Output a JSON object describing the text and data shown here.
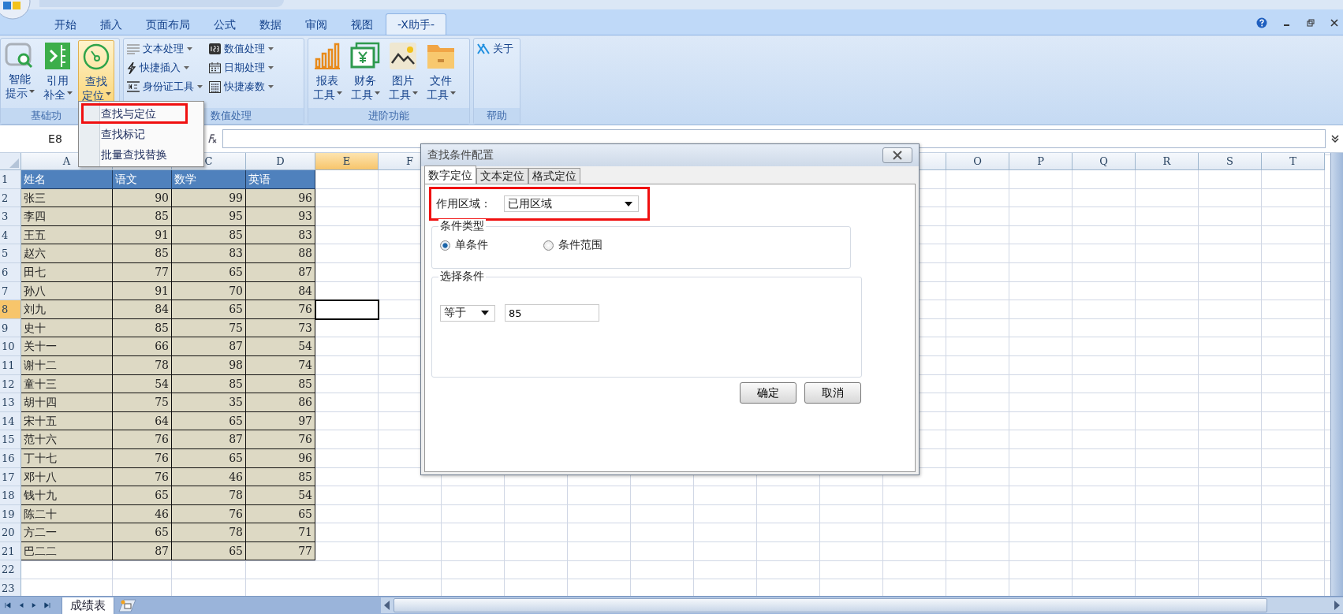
{
  "window": {
    "controls": [
      {
        "kind": "help"
      },
      {
        "kind": "minimize"
      },
      {
        "kind": "restore"
      },
      {
        "kind": "close"
      }
    ]
  },
  "ribbon_tabs": [
    {
      "label": "开始",
      "selected": false
    },
    {
      "label": "插入",
      "selected": false
    },
    {
      "label": "页面布局",
      "selected": false
    },
    {
      "label": "公式",
      "selected": false
    },
    {
      "label": "数据",
      "selected": false
    },
    {
      "label": "审阅",
      "selected": false
    },
    {
      "label": "视图",
      "selected": false
    },
    {
      "label": "-X助手-",
      "selected": true
    }
  ],
  "ribbon_groups": [
    {
      "label": "基础功",
      "big_buttons": [
        {
          "kind": "smart",
          "lines": [
            "智能",
            "提示"
          ],
          "selected": false
        },
        {
          "kind": "quote",
          "lines": [
            "引用",
            "补全"
          ],
          "selected": false
        },
        {
          "kind": "locate",
          "lines": [
            "查找",
            "定位"
          ],
          "selected": true
        }
      ]
    },
    {
      "label": "数值处理",
      "small_buttons": [
        {
          "kind": "text",
          "label": "文本处理",
          "has_menu": true
        },
        {
          "kind": "number",
          "label": "数值处理",
          "has_menu": true
        },
        {
          "kind": "insert",
          "label": "快捷插入",
          "has_menu": true
        },
        {
          "kind": "date",
          "label": "日期处理",
          "has_menu": true
        },
        {
          "kind": "id",
          "label": "身份证工具",
          "has_menu": true
        },
        {
          "kind": "sum",
          "label": "快捷凑数",
          "has_menu": true
        }
      ]
    },
    {
      "label": "进阶功能",
      "big_buttons": [
        {
          "kind": "report",
          "lines": [
            "报表",
            "工具"
          ],
          "selected": false
        },
        {
          "kind": "finance",
          "lines": [
            "财务",
            "工具"
          ],
          "selected": false
        },
        {
          "kind": "image",
          "lines": [
            "图片",
            "工具"
          ],
          "selected": false
        },
        {
          "kind": "file",
          "lines": [
            "文件",
            "工具"
          ],
          "selected": false
        }
      ]
    },
    {
      "label": "帮助",
      "small_buttons": [
        {
          "kind": "about",
          "label": "关于",
          "has_menu": false
        }
      ]
    }
  ],
  "dropdown_menu": {
    "items": [
      {
        "label": "查找与定位",
        "highlighted": true
      },
      {
        "label": "查找标记",
        "highlighted": false
      },
      {
        "label": "批量查找替换",
        "highlighted": false
      }
    ]
  },
  "name_box": {
    "value": "E8"
  },
  "sheet": {
    "columns": [
      {
        "label": "A",
        "selected": false
      },
      {
        "kind": "covered"
      },
      {
        "label": "C",
        "selected": false
      },
      {
        "label": "D",
        "selected": false
      },
      {
        "label": "E",
        "selected": true
      },
      {
        "label": "F",
        "selected": false
      },
      {
        "kind": "hidden"
      },
      {
        "kind": "hidden"
      },
      {
        "kind": "hidden"
      },
      {
        "kind": "hidden"
      },
      {
        "kind": "hidden"
      },
      {
        "kind": "hidden"
      },
      {
        "kind": "hidden"
      },
      {
        "kind": "covered"
      },
      {
        "label": "O",
        "selected": false
      },
      {
        "label": "P",
        "selected": false
      },
      {
        "label": "Q",
        "selected": false
      },
      {
        "label": "R",
        "selected": false
      },
      {
        "label": "S",
        "selected": false
      },
      {
        "label": "T",
        "selected": false
      }
    ],
    "rows": [
      {
        "number": "1",
        "kind": "header",
        "selected": false,
        "cells": [
          "姓名",
          "语文",
          "数学",
          "英语"
        ]
      },
      {
        "number": "2",
        "kind": "data",
        "selected": false,
        "cells": [
          "张三",
          "90",
          "99",
          "96"
        ]
      },
      {
        "number": "3",
        "kind": "data",
        "selected": false,
        "cells": [
          "李四",
          "85",
          "95",
          "93"
        ]
      },
      {
        "number": "4",
        "kind": "data",
        "selected": false,
        "cells": [
          "王五",
          "91",
          "85",
          "83"
        ]
      },
      {
        "number": "5",
        "kind": "data",
        "selected": false,
        "cells": [
          "赵六",
          "85",
          "83",
          "88"
        ]
      },
      {
        "number": "6",
        "kind": "data",
        "selected": false,
        "cells": [
          "田七",
          "77",
          "65",
          "87"
        ]
      },
      {
        "number": "7",
        "kind": "data",
        "selected": false,
        "cells": [
          "孙八",
          "91",
          "70",
          "84"
        ]
      },
      {
        "number": "8",
        "kind": "data",
        "selected": true,
        "cells": [
          "刘九",
          "84",
          "65",
          "76"
        ]
      },
      {
        "number": "9",
        "kind": "data",
        "selected": false,
        "cells": [
          "史十",
          "85",
          "75",
          "73"
        ]
      },
      {
        "number": "10",
        "kind": "data",
        "selected": false,
        "cells": [
          "关十一",
          "66",
          "87",
          "54"
        ]
      },
      {
        "number": "11",
        "kind": "data",
        "selected": false,
        "cells": [
          "谢十二",
          "78",
          "98",
          "74"
        ]
      },
      {
        "number": "12",
        "kind": "data",
        "selected": false,
        "cells": [
          "童十三",
          "54",
          "85",
          "85"
        ]
      },
      {
        "number": "13",
        "kind": "data",
        "selected": false,
        "cells": [
          "胡十四",
          "75",
          "35",
          "86"
        ]
      },
      {
        "number": "14",
        "kind": "data",
        "selected": false,
        "cells": [
          "宋十五",
          "64",
          "65",
          "97"
        ]
      },
      {
        "number": "15",
        "kind": "data",
        "selected": false,
        "cells": [
          "范十六",
          "76",
          "87",
          "76"
        ]
      },
      {
        "number": "16",
        "kind": "data",
        "selected": false,
        "cells": [
          "丁十七",
          "76",
          "65",
          "96"
        ]
      },
      {
        "number": "17",
        "kind": "data",
        "selected": false,
        "cells": [
          "邓十八",
          "76",
          "46",
          "85"
        ]
      },
      {
        "number": "18",
        "kind": "data",
        "selected": false,
        "cells": [
          "钱十九",
          "65",
          "78",
          "54"
        ]
      },
      {
        "number": "19",
        "kind": "data",
        "selected": false,
        "cells": [
          "陈二十",
          "46",
          "76",
          "65"
        ]
      },
      {
        "number": "20",
        "kind": "data",
        "selected": false,
        "cells": [
          "方二一",
          "65",
          "78",
          "71"
        ]
      },
      {
        "number": "21",
        "kind": "data",
        "selected": false,
        "cells": [
          "巴二二",
          "87",
          "65",
          "77"
        ]
      },
      {
        "number": "22",
        "kind": "empty",
        "selected": false
      },
      {
        "number": "23",
        "kind": "empty",
        "selected": false
      }
    ]
  },
  "dialog": {
    "title": "查找条件配置",
    "tabs": [
      {
        "label": "数字定位",
        "selected": true
      },
      {
        "label": "文本定位",
        "selected": false
      },
      {
        "label": "格式定位",
        "selected": false
      }
    ],
    "area": {
      "label": "作用区域：",
      "value": "已用区域",
      "highlighted": true
    },
    "condition_type": {
      "legend": "条件类型",
      "options": [
        {
          "label": "单条件",
          "selected": true
        },
        {
          "label": "条件范围",
          "selected": false
        }
      ]
    },
    "condition": {
      "legend": "选择条件",
      "operator": "等于",
      "value": "85"
    },
    "buttons": [
      "确定",
      "取消"
    ]
  },
  "sheet_tabs": [
    {
      "label": "成绩表",
      "selected": true
    }
  ]
}
